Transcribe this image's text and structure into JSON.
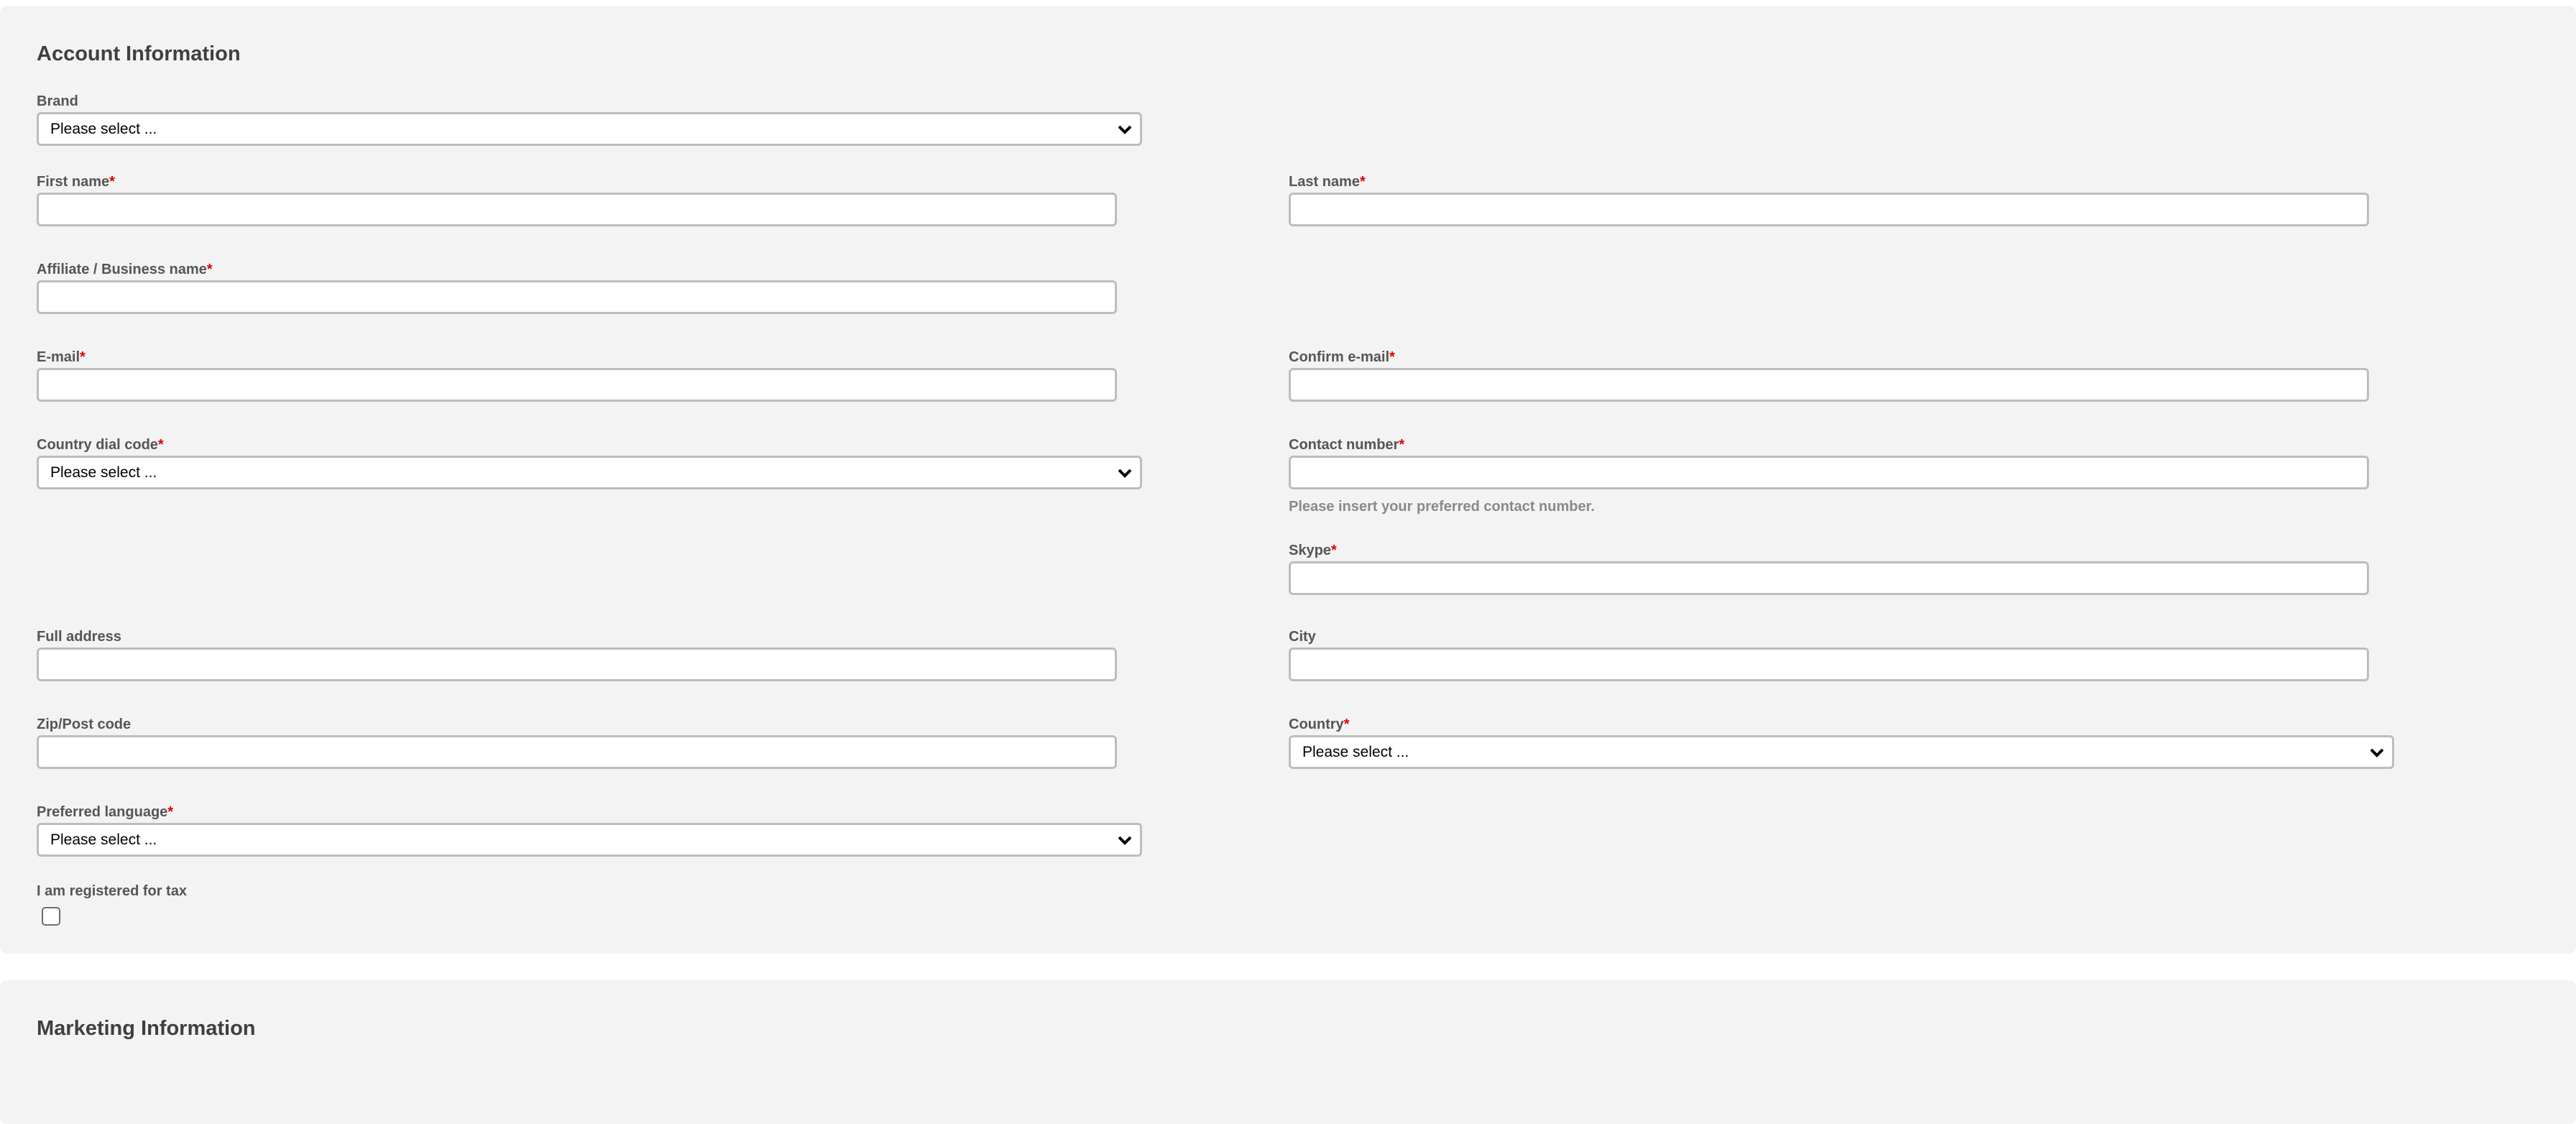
{
  "account": {
    "title": "Account Information",
    "required_mark": "*",
    "brand": {
      "label": "Brand",
      "value": "Please select ..."
    },
    "first_name": {
      "label": "First name",
      "value": ""
    },
    "last_name": {
      "label": "Last name",
      "value": ""
    },
    "affiliate_name": {
      "label": "Affiliate / Business name",
      "value": ""
    },
    "email": {
      "label": "E-mail",
      "value": ""
    },
    "confirm_email": {
      "label": "Confirm e-mail",
      "value": ""
    },
    "dial_code": {
      "label": "Country dial code",
      "value": "Please select ..."
    },
    "contact_number": {
      "label": "Contact number",
      "value": "",
      "help": "Please insert your preferred contact number."
    },
    "skype": {
      "label": "Skype",
      "value": ""
    },
    "full_address": {
      "label": "Full address",
      "value": ""
    },
    "city": {
      "label": "City",
      "value": ""
    },
    "zip": {
      "label": "Zip/Post code",
      "value": ""
    },
    "country": {
      "label": "Country",
      "value": "Please select ..."
    },
    "preferred_language": {
      "label": "Preferred language",
      "value": "Please select ..."
    },
    "tax_registered": {
      "label": "I am registered for tax",
      "checked": false
    }
  },
  "marketing": {
    "title": "Marketing Information"
  }
}
